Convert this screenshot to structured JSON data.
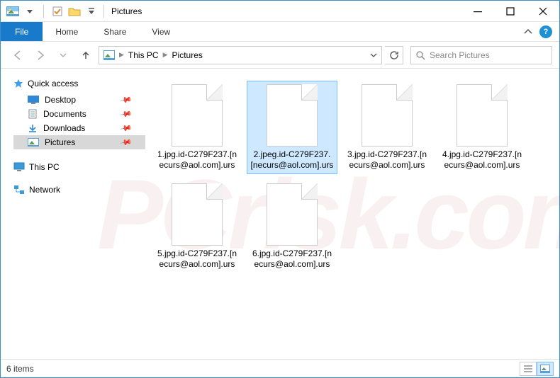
{
  "title": "Pictures",
  "ribbon": {
    "file": "File",
    "tabs": [
      "Home",
      "Share",
      "View"
    ]
  },
  "breadcrumb": [
    "This PC",
    "Pictures"
  ],
  "search": {
    "placeholder": "Search Pictures"
  },
  "sidebar": {
    "quick": {
      "label": "Quick access",
      "items": [
        {
          "label": "Desktop",
          "pinned": true
        },
        {
          "label": "Documents",
          "pinned": true
        },
        {
          "label": "Downloads",
          "pinned": true
        },
        {
          "label": "Pictures",
          "pinned": true,
          "selected": true
        }
      ]
    },
    "thispc": {
      "label": "This PC"
    },
    "network": {
      "label": "Network"
    }
  },
  "files": [
    "1.jpg.id-C279F237.[necurs@aol.com].urs",
    "2.jpeg.id-C279F237.[necurs@aol.com].urs",
    "3.jpg.id-C279F237.[necurs@aol.com].urs",
    "4.jpg.id-C279F237.[necurs@aol.com].urs",
    "5.jpg.id-C279F237.[necurs@aol.com].urs",
    "6.jpg.id-C279F237.[necurs@aol.com].urs"
  ],
  "selected_index": 1,
  "status": "6 items",
  "watermark": "PCrisk.com"
}
